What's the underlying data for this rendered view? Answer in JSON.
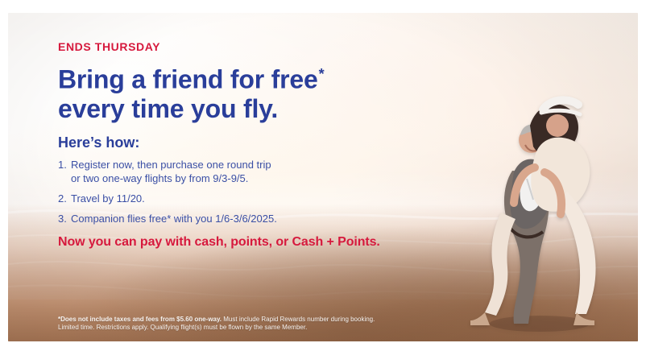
{
  "promo": {
    "kicker": "ENDS THURSDAY",
    "headline_line1": "Bring a friend for free",
    "headline_asterisk": "*",
    "headline_line2": "every time you fly.",
    "howto": "Here’s how:",
    "steps": [
      {
        "num": "1.",
        "text_line1": "Register now, then purchase one round trip",
        "text_line2": "or two one-way flights by from 9/3-9/5."
      },
      {
        "num": "2.",
        "text": "Travel by 11/20."
      },
      {
        "num": "3.",
        "text": "Companion flies free* with you 1/6-3/6/2025."
      }
    ],
    "cta": "Now you can pay with cash, points, or Cash + Points.",
    "fineprint": {
      "line1_bold": "*Does not include taxes and fees from $5.60 one-way.",
      "line1_rest": " Must include Rapid Rewards number during booking.",
      "line2": "Limited time. Restrictions apply. Qualifying flight(s) must be flown by the same Member."
    }
  },
  "colors": {
    "brand_blue": "#2a3e9a",
    "accent_red": "#d6193d",
    "text_blue": "#3a4fa5"
  },
  "image": {
    "scene_icon": "beach-scene-icon",
    "people_icon": "couple-piggyback-icon"
  }
}
